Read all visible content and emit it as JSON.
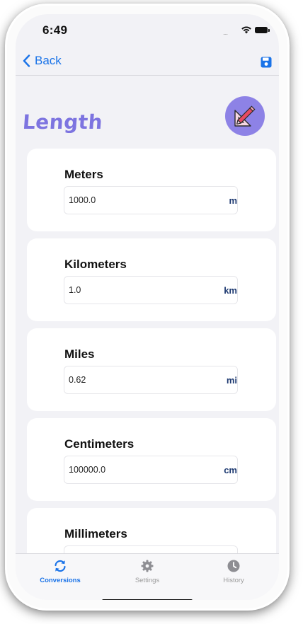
{
  "status": {
    "time": "6:49",
    "signal": "....."
  },
  "nav": {
    "back_label": "Back"
  },
  "header": {
    "title": "Length"
  },
  "conversions": [
    {
      "label": "Meters",
      "value": "1000.0",
      "unit": "m"
    },
    {
      "label": "Kilometers",
      "value": "1.0",
      "unit": "km"
    },
    {
      "label": "Miles",
      "value": "0.62",
      "unit": "mi"
    },
    {
      "label": "Centimeters",
      "value": "100000.0",
      "unit": "cm"
    },
    {
      "label": "Millimeters",
      "value": "",
      "unit": ""
    }
  ],
  "tabs": [
    {
      "label": "Conversions",
      "icon": "sync-icon",
      "active": true
    },
    {
      "label": "Settings",
      "icon": "gear-icon",
      "active": false
    },
    {
      "label": "History",
      "icon": "clock-icon",
      "active": false
    }
  ],
  "colors": {
    "accent": "#1a73e8",
    "title": "#7d74e0",
    "unit": "#1f3b72",
    "logo": "#8d82e6"
  }
}
